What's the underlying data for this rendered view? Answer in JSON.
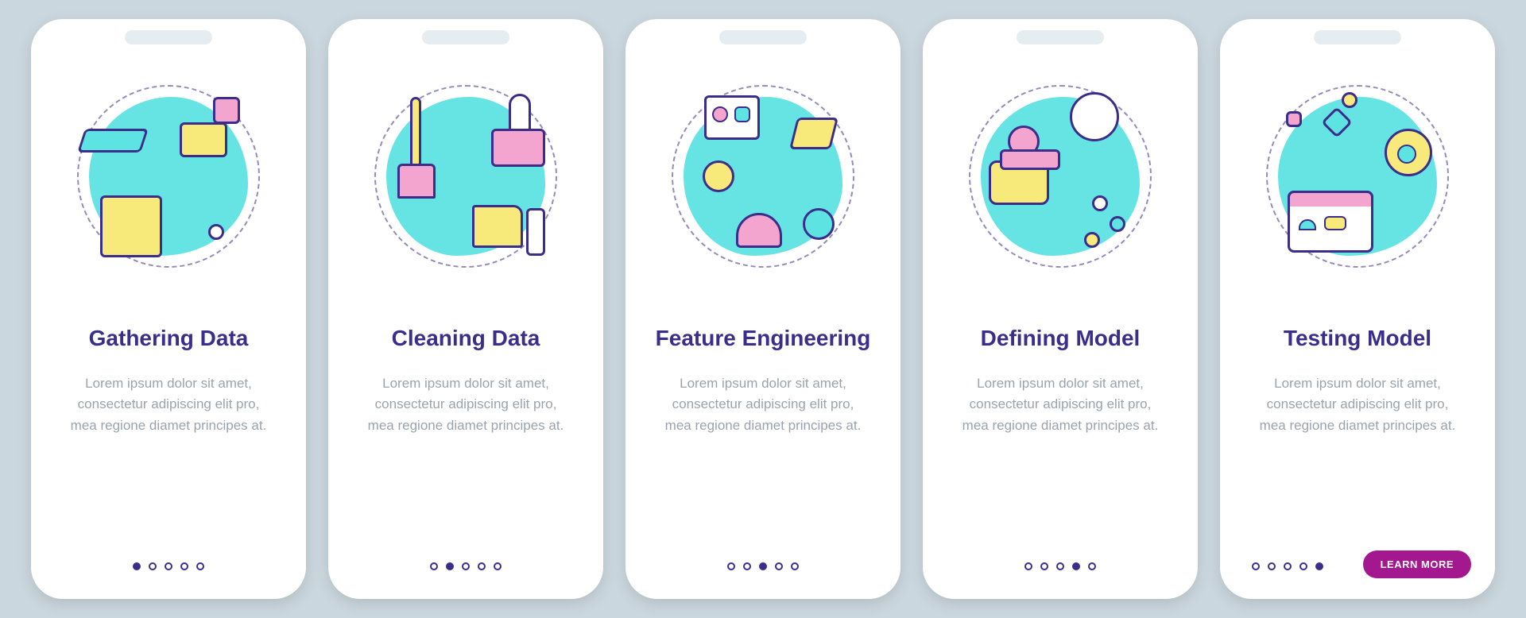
{
  "colors": {
    "background": "#cbd7de",
    "primary": "#3b2d8a",
    "accent": "#a3188f",
    "teal": "#5ee3e3",
    "yellow": "#f7e97a",
    "pink": "#f4a5cf",
    "grey_text": "#9aa3ad"
  },
  "cta_label": "LEARN MORE",
  "screens": [
    {
      "title": "Gathering Data",
      "description": "Lorem ipsum dolor sit amet, consectetur adipiscing elit pro, mea regione diamet principes at.",
      "active_dot": 0,
      "icon": "funnel-data-icon"
    },
    {
      "title": "Cleaning Data",
      "description": "Lorem ipsum dolor sit amet, consectetur adipiscing elit pro, mea regione diamet principes at.",
      "active_dot": 1,
      "icon": "broom-wrench-icon"
    },
    {
      "title": "Feature Engineering",
      "description": "Lorem ipsum dolor sit amet, consectetur adipiscing elit pro, mea regione diamet principes at.",
      "active_dot": 2,
      "icon": "shapes-funnel-icon"
    },
    {
      "title": "Defining Model",
      "description": "Lorem ipsum dolor sit amet, consectetur adipiscing elit pro, mea regione diamet principes at.",
      "active_dot": 3,
      "icon": "network-magnifier-icon"
    },
    {
      "title": "Testing Model",
      "description": "Lorem ipsum dolor sit amet, consectetur adipiscing elit pro, mea regione diamet principes at.",
      "active_dot": 4,
      "icon": "flowchart-dashboard-icon"
    }
  ]
}
